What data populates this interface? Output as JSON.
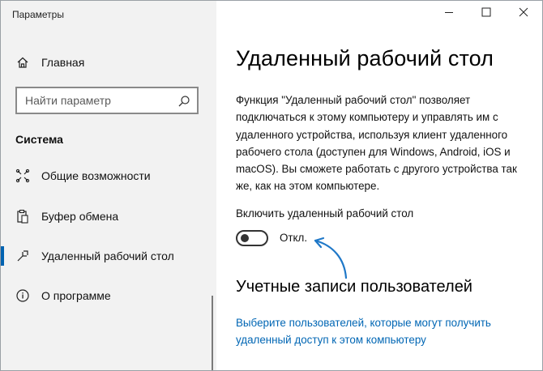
{
  "window": {
    "app_title": "Параметры",
    "controls": {
      "minimize_icon": "minimize-icon",
      "maximize_icon": "maximize-icon",
      "close_icon": "close-icon"
    }
  },
  "sidebar": {
    "home": {
      "label": "Главная",
      "icon": "home-icon"
    },
    "search": {
      "placeholder": "Найти параметр",
      "value": "",
      "icon": "search-icon"
    },
    "section_title": "Система",
    "items": [
      {
        "label": "Общие возможности",
        "icon": "shared-experiences-icon",
        "active": false
      },
      {
        "label": "Буфер обмена",
        "icon": "clipboard-icon",
        "active": false
      },
      {
        "label": "Удаленный рабочий стол",
        "icon": "remote-desktop-icon",
        "active": true
      },
      {
        "label": "О программе",
        "icon": "info-icon",
        "active": false
      }
    ],
    "accent_color": "#0063b1"
  },
  "main": {
    "title": "Удаленный рабочий стол",
    "description": "Функция \"Удаленный рабочий стол\" позволяет подключаться к этому компьютеру и управлять им с удаленного устройства, используя клиент удаленного рабочего стола (доступен для Windows, Android, iOS и macOS). Вы сможете работать с другого устройства так же, как на этом компьютере.",
    "toggle": {
      "label": "Включить удаленный рабочий стол",
      "state_text": "Откл.",
      "on": false
    },
    "accounts": {
      "heading": "Учетные записи пользователей",
      "link": "Выберите пользователей, которые могут получить удаленный доступ к этом компьютеру"
    },
    "annotation_arrow_color": "#1f78c8",
    "link_color": "#0066b4"
  }
}
